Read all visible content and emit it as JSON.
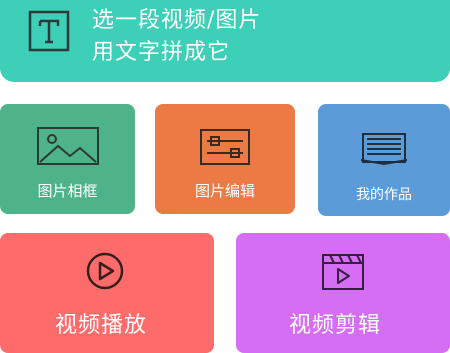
{
  "banner": {
    "line1": "选一段视频/图片",
    "line2": "用文字拼成它",
    "icon": "text-t-icon",
    "color": "#3ecfb8"
  },
  "tiles": {
    "photo_frame": {
      "label": "图片相框",
      "icon": "image-icon",
      "color": "#4fb38a"
    },
    "photo_edit": {
      "label": "图片编辑",
      "icon": "sliders-icon",
      "color": "#ec7a44"
    },
    "my_works": {
      "label": "我的作品",
      "icon": "stack-icon",
      "color": "#5a9bd8"
    },
    "video_play": {
      "label": "视频播放",
      "icon": "play-circle-icon",
      "color": "#fe6b6b"
    },
    "video_edit": {
      "label": "视频剪辑",
      "icon": "clapperboard-icon",
      "color": "#d56ef4"
    }
  }
}
